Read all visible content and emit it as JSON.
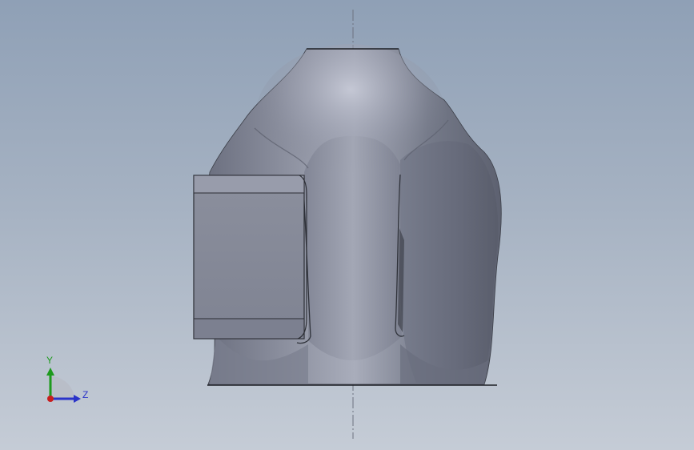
{
  "view": {
    "type": "3d-model-viewport",
    "background_colors": [
      "#8fa0b6",
      "#a7b3c3",
      "#c5ccd6"
    ],
    "model_color": "#7d8191"
  },
  "triad": {
    "y_label": "Y",
    "z_label": "Z",
    "y_color": "#1d9a1d",
    "z_color": "#2a33c9",
    "origin_color": "#c81e1e"
  }
}
